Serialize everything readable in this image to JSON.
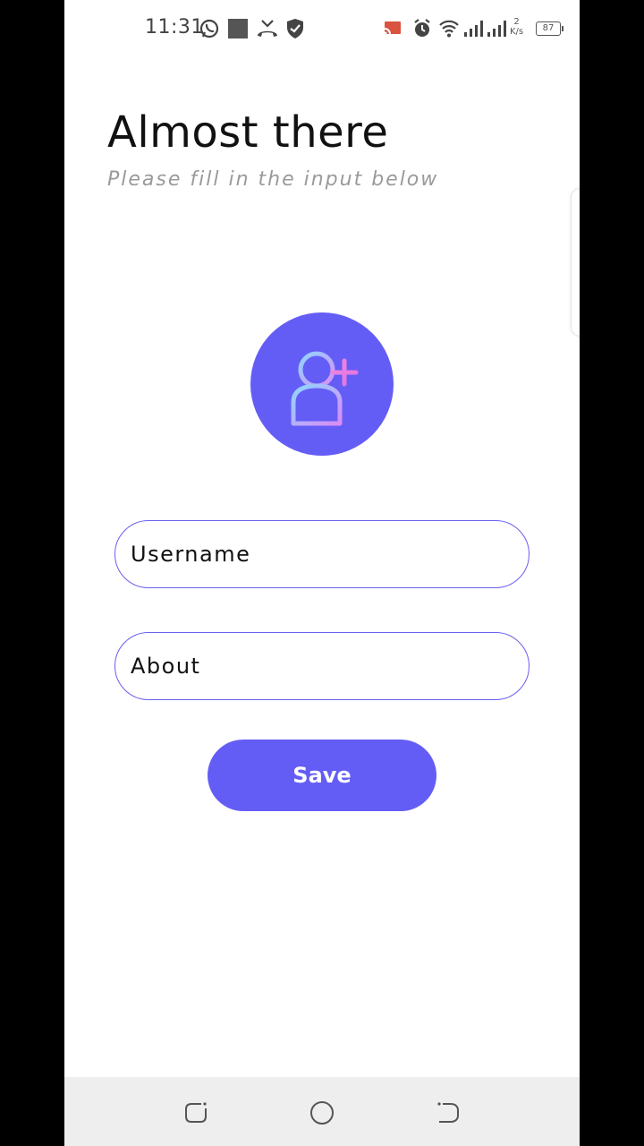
{
  "status_bar": {
    "time": "11:31",
    "net_speed_value": "2",
    "net_speed_unit": "K/s",
    "battery": "87",
    "icons": [
      "whatsapp-icon",
      "square-notification-icon",
      "missed-call-icon",
      "shield-icon",
      "cast-icon",
      "alarm-icon",
      "wifi-icon",
      "signal-icon",
      "signal-icon",
      "battery-icon"
    ]
  },
  "header": {
    "title": "Almost there",
    "subtitle": "Please fill in the input below"
  },
  "avatar": {
    "icon": "add-user-icon",
    "background": "#645df5"
  },
  "form": {
    "username_placeholder": "Username",
    "about_placeholder": "About",
    "save_label": "Save"
  },
  "colors": {
    "accent": "#645df5",
    "input_border": "#6a5ef0"
  },
  "nav_bar": {
    "icons": [
      "recent-apps-icon",
      "home-icon",
      "back-icon"
    ]
  }
}
